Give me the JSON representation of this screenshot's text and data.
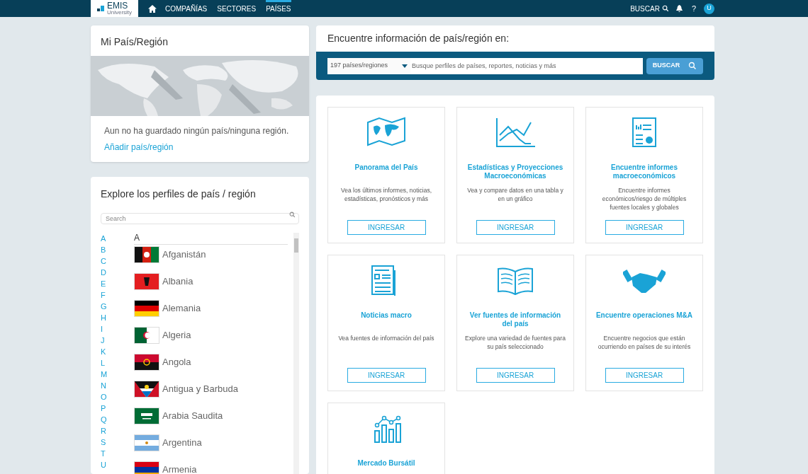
{
  "nav": {
    "logo": "EMIS",
    "logo_sub": "University",
    "items": [
      {
        "label": "COMPAÑÍAS",
        "selected": false
      },
      {
        "label": "SECTORES",
        "selected": false
      },
      {
        "label": "PAÍSES",
        "selected": true
      }
    ],
    "search_label": "BUSCAR",
    "help": "?",
    "avatar": "U"
  },
  "my_country": {
    "title": "Mi País/Región",
    "empty_text": "Aun no ha guardado ningún país/ninguna región.",
    "add_link": "Añadir país/región"
  },
  "explore": {
    "title": "Explore los perfiles de país / región",
    "search_placeholder": "Search",
    "letters": [
      "A",
      "B",
      "C",
      "D",
      "E",
      "F",
      "G",
      "H",
      "I",
      "J",
      "K",
      "L",
      "M",
      "N",
      "O",
      "P",
      "Q",
      "R",
      "S",
      "T",
      "U"
    ],
    "group": "A",
    "countries": [
      "Afganistán",
      "Albania",
      "Alemania",
      "Algeria",
      "Angola",
      "Antigua y Barbuda",
      "Arabia Saudita",
      "Argentina",
      "Armenia"
    ]
  },
  "finder": {
    "title": "Encuentre información de país/región en:",
    "select": "197 países/regiones",
    "placeholder": "Busque perfiles de países, reportes, noticias y más",
    "button": "BUSCAR"
  },
  "tiles": [
    {
      "title": "Panorama del País",
      "text": "Vea los últimos informes, noticias, estadísticas, pronósticos y más",
      "button": "INGRESAR"
    },
    {
      "title": "Estadísticas y Proyecciones Macroeconómicas",
      "text": "Vea y compare datos en una tabla y en un gráfico",
      "button": "INGRESAR"
    },
    {
      "title": "Encuentre informes macroeconómicos",
      "text": "Encuentre informes económicos/riesgo de múltiples fuentes locales y globales",
      "button": "INGRESAR"
    },
    {
      "title": "Noticias macro",
      "text": "Vea fuentes de información del país",
      "button": "INGRESAR"
    },
    {
      "title": "Ver fuentes de información del país",
      "text": "Explore una variedad de fuentes para su país seleccionado",
      "button": "INGRESAR"
    },
    {
      "title": "Encuentre operaciones M&A",
      "text": "Encuentre negocios que están ocurriendo en países de su interés",
      "button": "INGRESAR"
    },
    {
      "title": "Mercado Bursátil"
    }
  ]
}
